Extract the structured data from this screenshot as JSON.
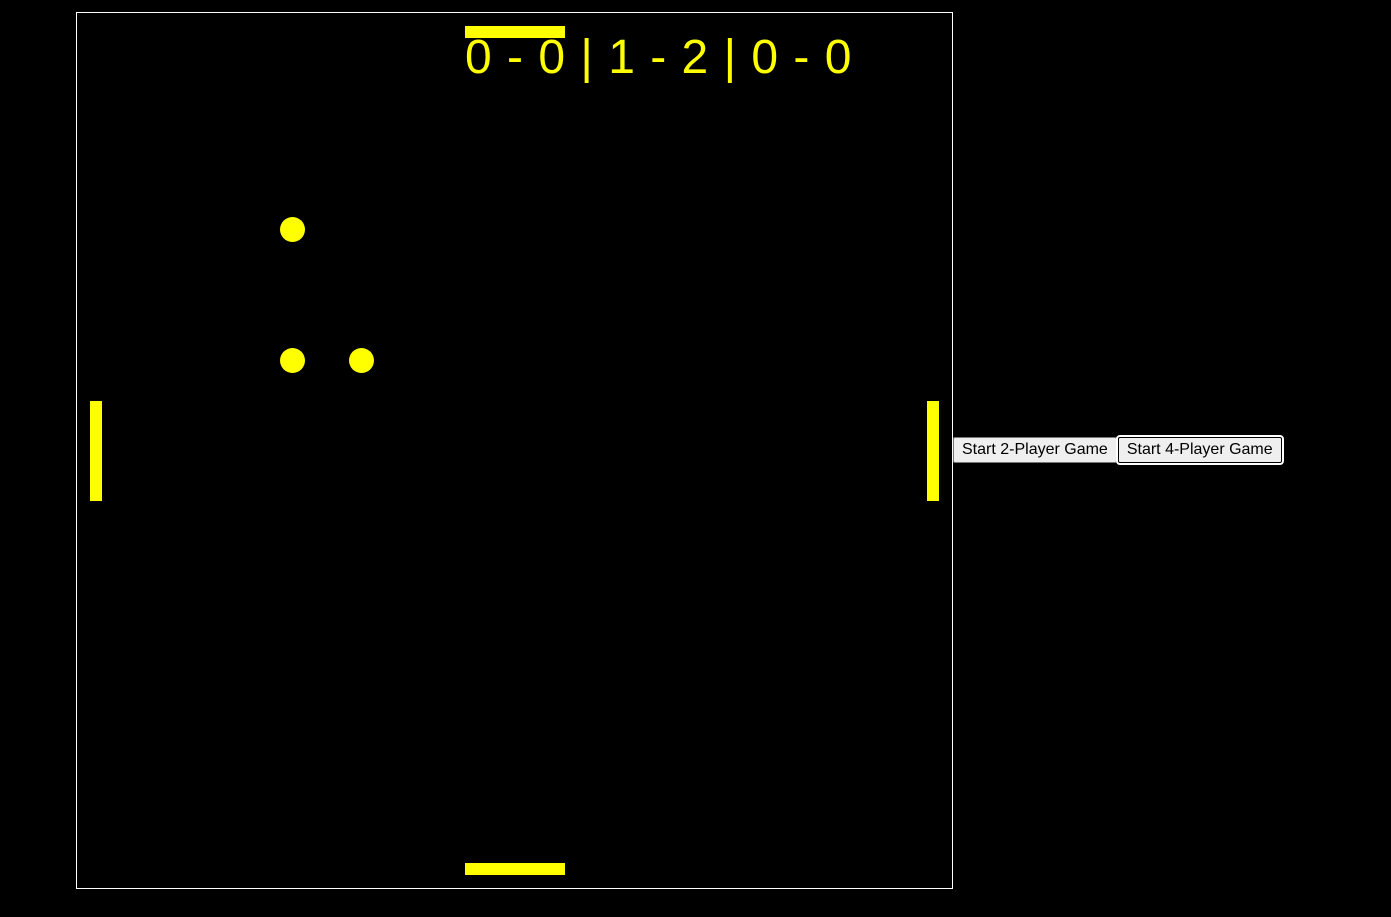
{
  "colors": {
    "background": "#000000",
    "board_border": "#ffffff",
    "game_elements": "#ffff00"
  },
  "game": {
    "scoreboard": "0 - 0 | 1 - 2 | 0 - 0",
    "ball_count": 3,
    "paddles": [
      "top",
      "bottom",
      "left",
      "right"
    ]
  },
  "controls": {
    "start_two_player_label": "Start 2-Player Game",
    "start_four_player_label": "Start 4-Player Game"
  }
}
